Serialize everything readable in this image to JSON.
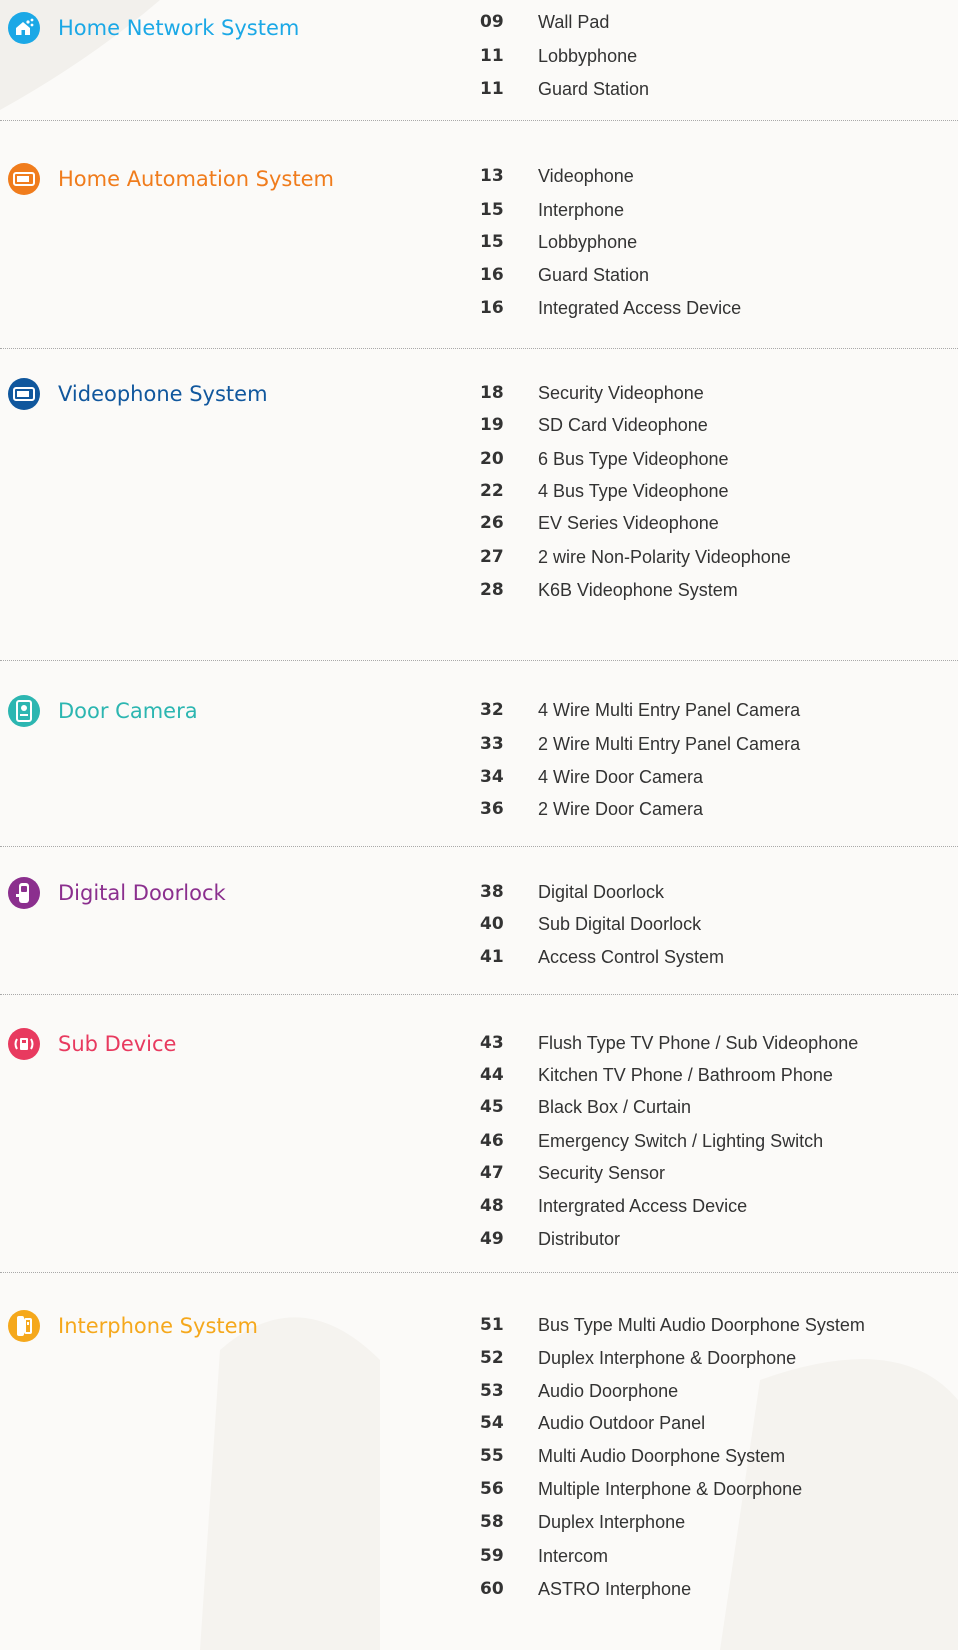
{
  "sections": [
    {
      "title": "Home Network System",
      "icon": "house-network-icon",
      "color": "#1ba8e6",
      "items": [
        {
          "page": "09",
          "label": "Wall Pad"
        },
        {
          "page": "11",
          "label": "Lobbyphone"
        },
        {
          "page": "11",
          "label": "Guard Station"
        }
      ]
    },
    {
      "title": "Home Automation System",
      "icon": "videophone-screen-icon",
      "color": "#f07c1c",
      "items": [
        {
          "page": "13",
          "label": "Videophone"
        },
        {
          "page": "15",
          "label": "Interphone"
        },
        {
          "page": "15",
          "label": "Lobbyphone"
        },
        {
          "page": "16",
          "label": "Guard Station"
        },
        {
          "page": "16",
          "label": "Integrated Access Device"
        }
      ]
    },
    {
      "title": "Videophone System",
      "icon": "monitor-icon",
      "color": "#10579d",
      "items": [
        {
          "page": "18",
          "label": "Security Videophone"
        },
        {
          "page": "19",
          "label": "SD Card Videophone"
        },
        {
          "page": "20",
          "label": "6 Bus Type Videophone"
        },
        {
          "page": "22",
          "label": "4 Bus Type Videophone"
        },
        {
          "page": "26",
          "label": "EV Series Videophone"
        },
        {
          "page": "27",
          "label": "2 wire Non-Polarity Videophone"
        },
        {
          "page": "28",
          "label": "K6B Videophone System"
        }
      ]
    },
    {
      "title": "Door Camera",
      "icon": "door-camera-icon",
      "color": "#2cb6b1",
      "items": [
        {
          "page": "32",
          "label": "4 Wire Multi Entry Panel Camera"
        },
        {
          "page": "33",
          "label": "2 Wire Multi Entry Panel Camera"
        },
        {
          "page": "34",
          "label": "4 Wire Door Camera"
        },
        {
          "page": "36",
          "label": "2 Wire Door Camera"
        }
      ]
    },
    {
      "title": "Digital Doorlock",
      "icon": "doorlock-icon",
      "color": "#8b2f8e",
      "items": [
        {
          "page": "38",
          "label": "Digital Doorlock"
        },
        {
          "page": "40",
          "label": "Sub Digital Doorlock"
        },
        {
          "page": "41",
          "label": "Access Control System"
        }
      ]
    },
    {
      "title": "Sub Device",
      "icon": "signal-device-icon",
      "color": "#e83a5f",
      "items": [
        {
          "page": "43",
          "label": "Flush Type TV Phone / Sub Videophone"
        },
        {
          "page": "44",
          "label": "Kitchen TV Phone / Bathroom Phone"
        },
        {
          "page": "45",
          "label": "Black Box / Curtain"
        },
        {
          "page": "46",
          "label": "Emergency Switch / Lighting Switch"
        },
        {
          "page": "47",
          "label": "Security Sensor"
        },
        {
          "page": "48",
          "label": "Intergrated Access Device"
        },
        {
          "page": "49",
          "label": "Distributor"
        }
      ]
    },
    {
      "title": "Interphone System",
      "icon": "interphone-icon",
      "color": "#f5a81c",
      "items": [
        {
          "page": "51",
          "label": "Bus Type Multi Audio Doorphone System"
        },
        {
          "page": "52",
          "label": "Duplex Interphone & Doorphone"
        },
        {
          "page": "53",
          "label": "Audio Doorphone"
        },
        {
          "page": "54",
          "label": "Audio Outdoor Panel"
        },
        {
          "page": "55",
          "label": "Multi Audio Doorphone System"
        },
        {
          "page": "56",
          "label": "Multiple Interphone & Doorphone"
        },
        {
          "page": "58",
          "label": "Duplex Interphone"
        },
        {
          "page": "59",
          "label": "Intercom"
        },
        {
          "page": "60",
          "label": "ASTRO Interphone"
        }
      ]
    }
  ]
}
